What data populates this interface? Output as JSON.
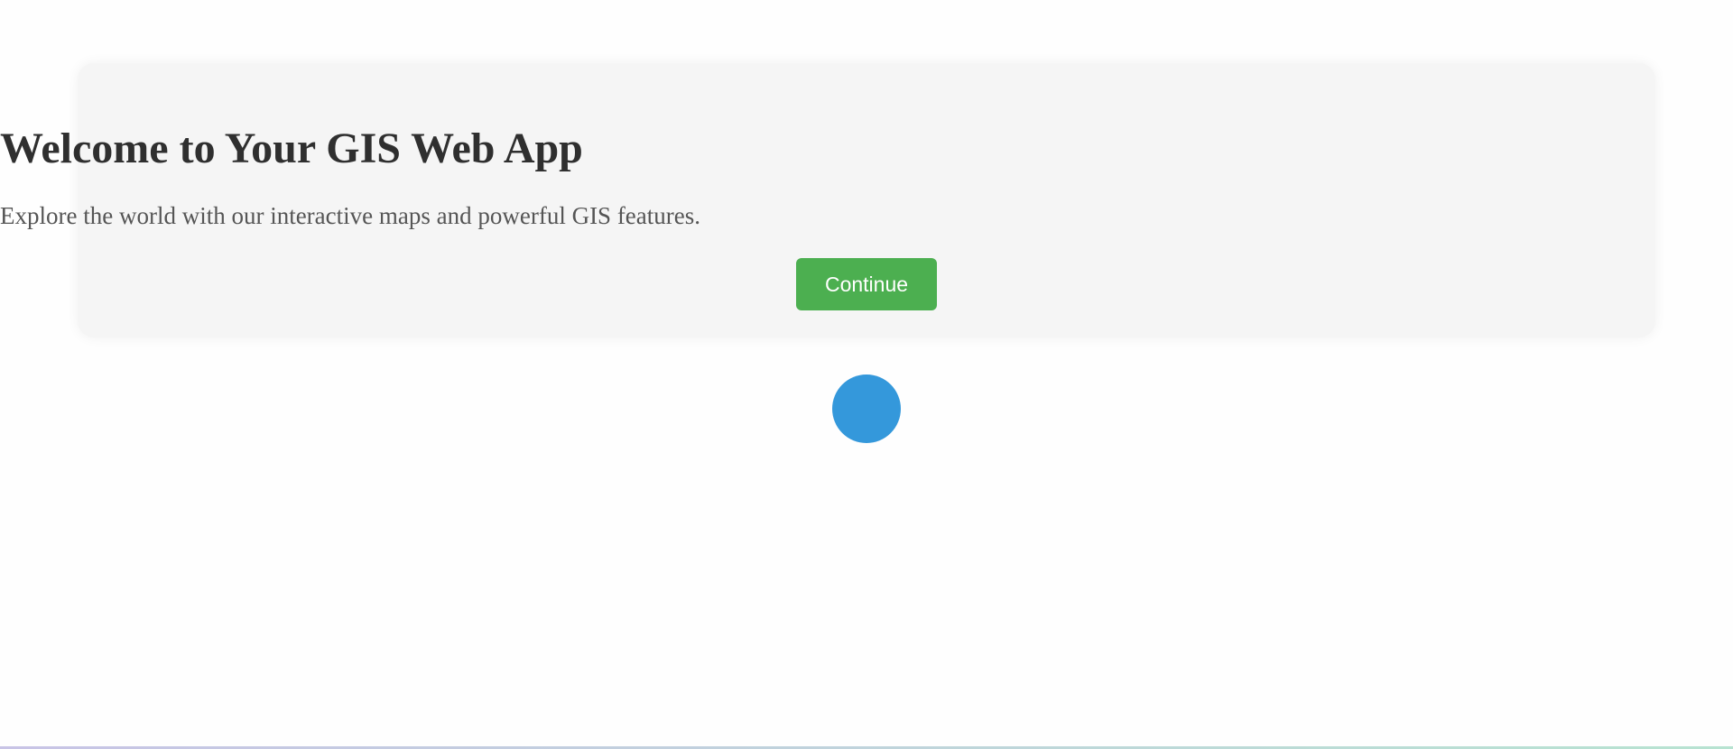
{
  "welcome": {
    "title": "Welcome to Your GIS Web App",
    "subtitle": "Explore the world with our interactive maps and powerful GIS features.",
    "continue_label": "Continue"
  },
  "colors": {
    "card_background": "#f5f5f5",
    "title_text": "#2f2f2f",
    "subtitle_text": "#555555",
    "button_background": "#4caf50",
    "button_text": "#ffffff",
    "loading_indicator": "#3498db"
  },
  "icons": {
    "loading": "loading-indicator-circle"
  }
}
